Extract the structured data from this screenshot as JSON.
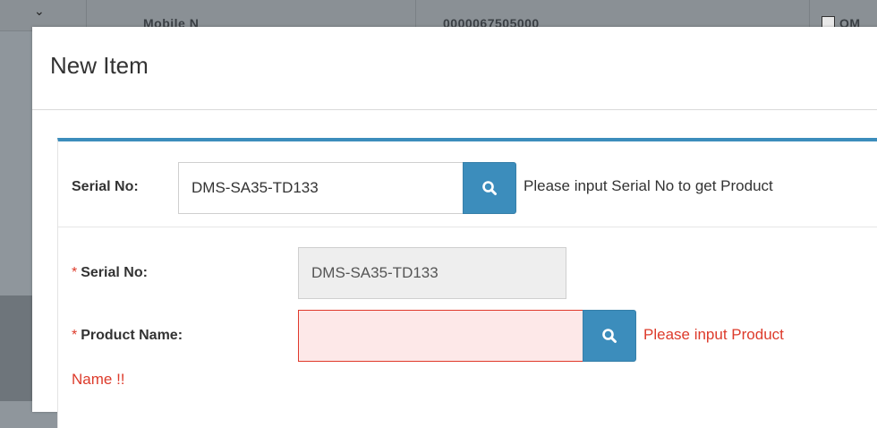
{
  "background": {
    "header_text_partial": "Mobile N",
    "value_partial": "0000067505000",
    "check_label_partial": "OM"
  },
  "modal": {
    "title": "New Item"
  },
  "lookup": {
    "label": "Serial No:",
    "value": "DMS-SA35-TD133",
    "hint": "Please input Serial No to get Product"
  },
  "form": {
    "required_marker": "*",
    "serial_label": "Serial No:",
    "serial_value": "DMS-SA35-TD133",
    "product_label": "Product Name:",
    "product_value": "",
    "product_error_line1": "Please input Product",
    "product_error_line2": "Name !!"
  },
  "colors": {
    "accent": "#3c8dbc",
    "error": "#dd3b2b"
  }
}
